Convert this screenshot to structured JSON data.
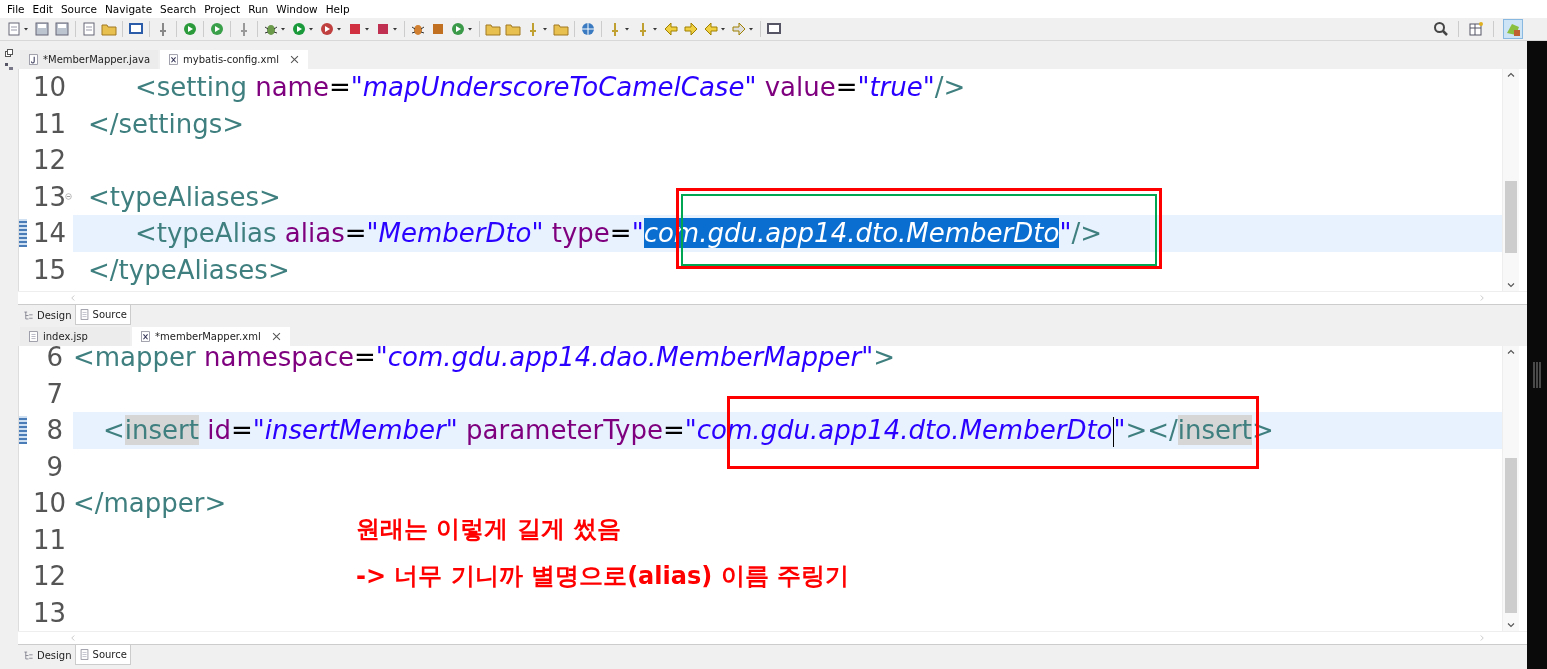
{
  "menu": [
    "File",
    "Edit",
    "Source",
    "Navigate",
    "Search",
    "Project",
    "Run",
    "Window",
    "Help"
  ],
  "editors": [
    {
      "tabs": [
        {
          "label": "*MemberMapper.java",
          "selected": false,
          "kind": "java"
        },
        {
          "label": "mybatis-config.xml",
          "selected": true,
          "kind": "xml"
        }
      ],
      "lines": [
        {
          "number": "10",
          "current": false,
          "modified": false,
          "foldable": false,
          "indented": true,
          "nested": true,
          "tokens": [
            {
              "kind": "tag",
              "text": "<setting"
            },
            {
              "kind": "attr",
              "text": " name"
            },
            {
              "kind": "eq",
              "text": "="
            },
            {
              "kind": "value",
              "text": "\"mapUnderscoreToCamelCase\""
            },
            {
              "kind": "attr",
              "text": " value"
            },
            {
              "kind": "eq",
              "text": "="
            },
            {
              "kind": "value",
              "text": "\"true\""
            },
            {
              "kind": "tag",
              "text": "/>"
            }
          ]
        },
        {
          "number": "11",
          "current": false,
          "modified": false,
          "foldable": false,
          "indented": true,
          "tokens": [
            {
              "kind": "tag",
              "text": "</settings>"
            }
          ]
        },
        {
          "number": "12",
          "current": false,
          "modified": false,
          "foldable": false
        },
        {
          "number": "13",
          "current": false,
          "modified": false,
          "foldable": true,
          "indented": true,
          "tokens": [
            {
              "kind": "tag",
              "text": "<typeAliases>"
            }
          ]
        },
        {
          "number": "14",
          "current": true,
          "modified": true,
          "foldable": false,
          "indented": true,
          "nested": true,
          "tokens": [
            {
              "kind": "tag",
              "text": "<typeAlias"
            },
            {
              "kind": "attr",
              "text": " alias"
            },
            {
              "kind": "eq",
              "text": "="
            },
            {
              "kind": "value",
              "text": "\"MemberDto\""
            },
            {
              "kind": "attr",
              "text": " type"
            },
            {
              "kind": "eq",
              "text": "="
            },
            {
              "kind": "value",
              "text": "\""
            },
            {
              "kind": "value",
              "text": "com.gdu.app14.dto.MemberDto",
              "selected": true
            },
            {
              "kind": "value",
              "text": "\""
            },
            {
              "kind": "tag",
              "text": "/>"
            }
          ]
        },
        {
          "number": "15",
          "current": false,
          "modified": false,
          "foldable": false,
          "indented": true,
          "tokens": [
            {
              "kind": "tag",
              "text": "</typeAliases>"
            }
          ]
        }
      ],
      "annotations": [
        {
          "kind": "box",
          "color": "#ff0000"
        },
        {
          "kind": "box",
          "color": "#00a651"
        }
      ],
      "view_tabs": [
        {
          "label": "Design",
          "selected": false
        },
        {
          "label": "Source",
          "selected": true
        }
      ]
    },
    {
      "tabs": [
        {
          "label": "index.jsp",
          "selected": false,
          "kind": "jsp"
        },
        {
          "label": "*memberMapper.xml",
          "selected": true,
          "kind": "xml"
        }
      ],
      "lines": [
        {
          "number": "6",
          "current": false,
          "modified": false,
          "foldable": false,
          "tokens": [
            {
              "kind": "tag",
              "text": "<mapper"
            },
            {
              "kind": "attr",
              "text": " namespace"
            },
            {
              "kind": "eq",
              "text": "="
            },
            {
              "kind": "value",
              "text": "\"com.gdu.app14.dao.MemberMapper\""
            },
            {
              "kind": "tag",
              "text": ">"
            }
          ]
        },
        {
          "number": "7",
          "current": false,
          "modified": false,
          "foldable": false
        },
        {
          "number": "8",
          "current": true,
          "modified": true,
          "foldable": false,
          "indented": true,
          "tokens": [
            {
              "kind": "tag",
              "text": "<"
            },
            {
              "kind": "tag",
              "text": "insert",
              "matched": true
            },
            {
              "kind": "attr",
              "text": " id"
            },
            {
              "kind": "eq",
              "text": "="
            },
            {
              "kind": "value",
              "text": "\"insertMember\""
            },
            {
              "kind": "attr",
              "text": " parameterType"
            },
            {
              "kind": "eq",
              "text": "="
            },
            {
              "kind": "value",
              "text": "\"com.gdu.app14.dto.MemberDto",
              "cursor": true
            },
            {
              "kind": "value",
              "text": "\""
            },
            {
              "kind": "tag",
              "text": "></"
            },
            {
              "kind": "tag",
              "text": "insert",
              "matched": true
            },
            {
              "kind": "tag",
              "text": ">"
            }
          ]
        },
        {
          "number": "9",
          "current": false,
          "modified": false,
          "foldable": false
        },
        {
          "number": "10",
          "current": false,
          "modified": false,
          "foldable": false,
          "tokens": [
            {
              "kind": "tag",
              "text": "</mapper>"
            }
          ]
        },
        {
          "number": "11",
          "current": false,
          "modified": false,
          "foldable": false
        },
        {
          "number": "12",
          "current": false,
          "modified": false,
          "foldable": false
        },
        {
          "number": "13",
          "current": false,
          "modified": false,
          "foldable": false
        }
      ],
      "annotations": [
        {
          "kind": "box",
          "color": "#ff0000"
        }
      ],
      "notes": [
        {
          "text": "원래는 이렇게 길게 썼음",
          "color": "#ff0000"
        },
        {
          "text": "-> 너무 기니까 별명으로(alias) 이름 주링기",
          "color": "#ff0000"
        }
      ],
      "view_tabs": [
        {
          "label": "Design",
          "selected": false
        },
        {
          "label": "Source",
          "selected": true
        }
      ]
    }
  ]
}
